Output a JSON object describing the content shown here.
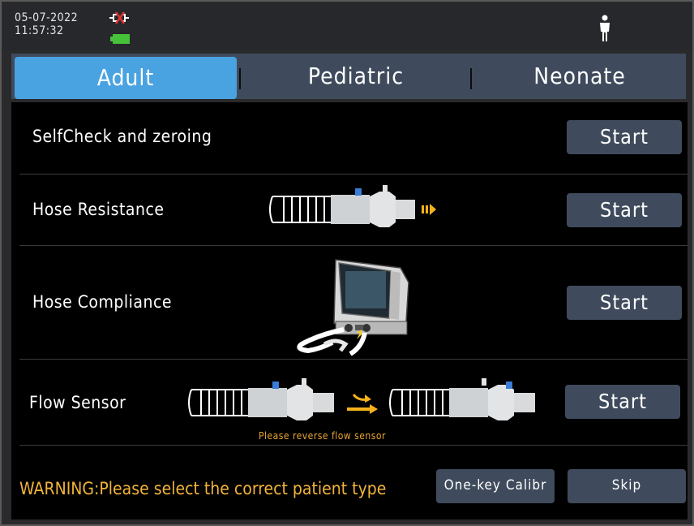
{
  "status": {
    "date": "05-07-2022",
    "time": "11:57:32",
    "icons": [
      "ac-power-disconnected-icon",
      "battery-icon",
      "adult-patient-icon"
    ],
    "battery_color": "#46c23a",
    "plug_color": "#e0322f"
  },
  "tabs": [
    {
      "label": "Adult",
      "active": true
    },
    {
      "label": "Pediatric",
      "active": false
    },
    {
      "label": "Neonate",
      "active": false
    }
  ],
  "rows": [
    {
      "label": "SelfCheck and zeroing",
      "button": "Start"
    },
    {
      "label": "Hose Resistance",
      "button": "Start"
    },
    {
      "label": "Hose Compliance",
      "button": "Start"
    },
    {
      "label": "Flow Sensor",
      "button": "Start"
    }
  ],
  "flow_sensor_hint": "Please reverse flow sensor",
  "footer": {
    "warning": "WARNING:Please select  the correct patient type",
    "calibrate_button": "One-key Calibr",
    "skip_button": "Skip"
  },
  "colors": {
    "accent": "#4aa3e1",
    "button_bg": "#3f4b5c",
    "warning": "#f2b43a",
    "arrow": "#f5b21b"
  }
}
